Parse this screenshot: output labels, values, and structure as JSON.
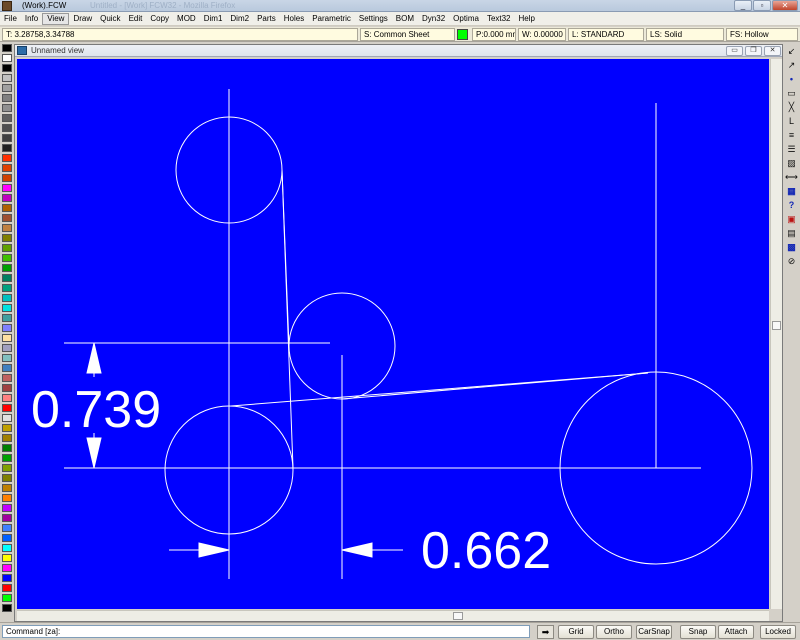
{
  "window": {
    "title": "(Work).FCW",
    "ghost_title": "Untitled  -  [Work]  FCW32  -  Mozilla Firefox"
  },
  "window_controls": {
    "minimize": "_",
    "maximize": "▫",
    "close": "✕"
  },
  "menu": [
    "File",
    "Info",
    "View",
    "Draw",
    "Quick",
    "Edit",
    "Copy",
    "MOD",
    "Dim1",
    "Dim2",
    "Parts",
    "Holes",
    "Parametric",
    "Settings",
    "BOM",
    "Dyn32",
    "Optima",
    "Text32",
    "Help"
  ],
  "status": {
    "coords": "T: 3.28758,3.34788",
    "sheet": "S: Common Sheet",
    "pen": "P:0.000 mm",
    "width": "W: 0.00000",
    "layer": "L: STANDARD",
    "line_style": "LS: Solid",
    "fill_style": "FS: Hollow",
    "pen_color": "#00ff00"
  },
  "view": {
    "title": "Unnamed view",
    "controls": {
      "minimize": "▭",
      "restore": "❐",
      "close": "✕"
    },
    "background": "#0000ff"
  },
  "drawing": {
    "dim_vertical": "0.739",
    "dim_horizontal": "0.662"
  },
  "palette": [
    "#000000",
    "#ffffff",
    "#000000",
    "#c0c0c0",
    "#a0a0a0",
    "#808080",
    "#909090",
    "#606060",
    "#505050",
    "#404040",
    "#202020",
    "#ff3000",
    "#e04000",
    "#d04000",
    "#ff00ff",
    "#c000c0",
    "#b06000",
    "#a05030",
    "#c08040",
    "#808000",
    "#60a000",
    "#40c000",
    "#00a000",
    "#008060",
    "#00a080",
    "#00c0c0",
    "#00e0e0",
    "#40a0a0",
    "#8080ff",
    "#ffe0a0",
    "#a0a0c0",
    "#80c0c0",
    "#4080c0",
    "#c06060",
    "#a04040",
    "#ff8080",
    "#ff0000",
    "#e0e0e0",
    "#c0a000",
    "#a08000",
    "#008000",
    "#00a000",
    "#80a000",
    "#808000",
    "#c08000",
    "#ff8000",
    "#c000ff",
    "#a000a0",
    "#4080ff",
    "#0060ff",
    "#00ffff",
    "#ffff00",
    "#ff00ff",
    "#0000ff",
    "#ff0000",
    "#00ff00",
    "#000000"
  ],
  "right_tools": [
    {
      "glyph": "↙",
      "name": "arrow-down-left-icon",
      "cls": ""
    },
    {
      "glyph": "↗",
      "name": "arrow-up-right-icon",
      "cls": ""
    },
    {
      "glyph": "•",
      "name": "point-icon",
      "cls": "blue"
    },
    {
      "glyph": "▭",
      "name": "rectangle-icon",
      "cls": ""
    },
    {
      "glyph": "╳",
      "name": "cross-icon",
      "cls": ""
    },
    {
      "glyph": "L",
      "name": "l-icon",
      "cls": ""
    },
    {
      "glyph": "≡",
      "name": "lines-icon",
      "cls": ""
    },
    {
      "glyph": "☰",
      "name": "list-icon",
      "cls": ""
    },
    {
      "glyph": "▨",
      "name": "hatch-icon",
      "cls": ""
    },
    {
      "glyph": "⟷",
      "name": "dimension-icon",
      "cls": ""
    },
    {
      "glyph": "▦",
      "name": "table-icon",
      "cls": "blue"
    },
    {
      "glyph": "?",
      "name": "help-icon",
      "cls": "blue"
    },
    {
      "glyph": "▣",
      "name": "stop-icon",
      "cls": "red"
    },
    {
      "glyph": "▤",
      "name": "layers-icon",
      "cls": ""
    },
    {
      "glyph": "▩",
      "name": "grid-icon",
      "cls": "blue"
    },
    {
      "glyph": "⊘",
      "name": "no-snap-icon",
      "cls": ""
    }
  ],
  "command": {
    "value": "Command [za]:",
    "arrow": "➡"
  },
  "buttons": [
    "Grid",
    "Ortho",
    "CarSnap",
    "Snap",
    "Attach",
    "Locked"
  ]
}
